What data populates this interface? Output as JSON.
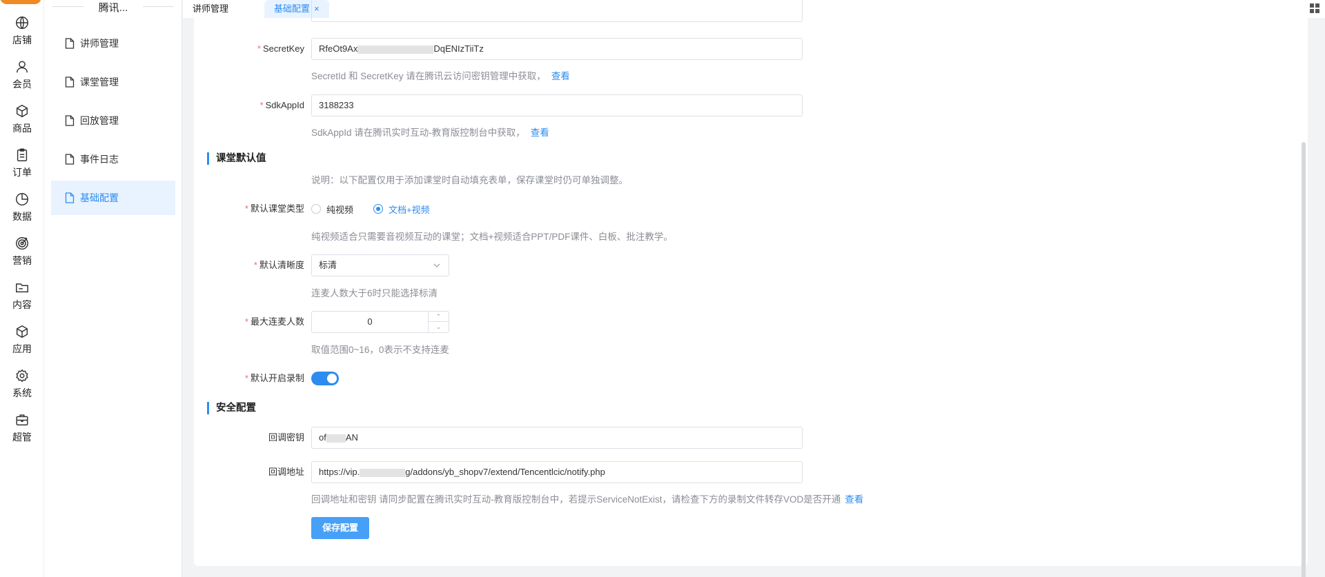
{
  "rail": {
    "items": [
      {
        "label": "店铺",
        "icon": "globe-icon"
      },
      {
        "label": "会员",
        "icon": "user-icon"
      },
      {
        "label": "商品",
        "icon": "box-icon"
      },
      {
        "label": "订单",
        "icon": "clipboard-icon"
      },
      {
        "label": "数据",
        "icon": "pie-chart-icon"
      },
      {
        "label": "营销",
        "icon": "target-icon"
      },
      {
        "label": "内容",
        "icon": "folder-icon"
      },
      {
        "label": "应用",
        "icon": "cube-icon"
      },
      {
        "label": "系统",
        "icon": "gear-icon"
      },
      {
        "label": "超管",
        "icon": "briefcase-icon"
      }
    ]
  },
  "sidebar": {
    "title": "腾讯...",
    "items": [
      {
        "label": "讲师管理",
        "active": false
      },
      {
        "label": "课堂管理",
        "active": false
      },
      {
        "label": "回放管理",
        "active": false
      },
      {
        "label": "事件日志",
        "active": false
      },
      {
        "label": "基础配置",
        "active": true
      }
    ]
  },
  "tabs": [
    {
      "label": "讲师管理",
      "active": false
    },
    {
      "label": "基础配置",
      "active": true,
      "close": "×"
    }
  ],
  "form": {
    "secret_key": {
      "label": "SecretKey",
      "value_start": "RfeOt9Ax",
      "value_end": "DqENIzTiiTz",
      "help": "SecretId 和 SecretKey 请在腾讯云访问密钥管理中获取，",
      "link": "查看"
    },
    "sdk_app_id": {
      "label": "SdkAppId",
      "value": "3188233",
      "help": "SdkAppId 请在腾讯实时互动-教育版控制台中获取，",
      "link": "查看"
    },
    "classroom_section": {
      "title": "课堂默认值",
      "desc": "说明：以下配置仅用于添加课堂时自动填充表单，保存课堂时仍可单独调整。"
    },
    "class_type": {
      "label": "默认课堂类型",
      "options": [
        "纯视频",
        "文档+视频"
      ],
      "selected": "文档+视频",
      "help": "纯视频适合只需要音视频互动的课堂；文档+视频适合PPT/PDF课件、白板、批注教学。"
    },
    "resolution": {
      "label": "默认清晰度",
      "value": "标清",
      "help": "连麦人数大于6时只能选择标清"
    },
    "max_mic": {
      "label": "最大连麦人数",
      "value": "0",
      "help": "取值范围0~16，0表示不支持连麦"
    },
    "recording": {
      "label": "默认开启录制",
      "on": true
    },
    "security_section": {
      "title": "安全配置"
    },
    "callback_key": {
      "label": "回调密钥",
      "value_start": "of",
      "value_end": "AN"
    },
    "callback_url": {
      "label": "回调地址",
      "value_start": "https://vip.",
      "value_end": "g/addons/yb_shopv7/extend/Tencentlcic/notify.php",
      "help": "回调地址和密钥 请同步配置在腾讯实时互动-教育版控制台中，若提示ServiceNotExist，请检查下方的录制文件转存VOD是否开通",
      "link": "查看"
    },
    "save_label": "保存配置"
  },
  "colors": {
    "accent": "#2d8cf0",
    "required": "#f56c6c",
    "help_text": "#8b8e94",
    "active_bg": "#e8f3ff",
    "logo": "#f08a24"
  }
}
